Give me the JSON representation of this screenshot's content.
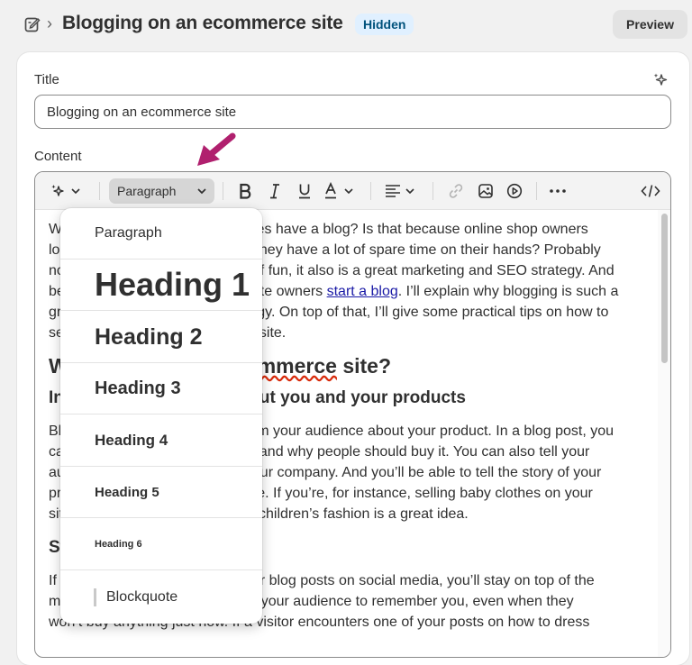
{
  "header": {
    "title": "Blogging on an ecommerce site",
    "badge": "Hidden",
    "preview_label": "Preview",
    "breadcrumb_separator": "›",
    "page_icon": "edit-page-icon"
  },
  "form": {
    "title_label": "Title",
    "title_value": "Blogging on an ecommerce site",
    "content_label": "Content"
  },
  "toolbar": {
    "block_format": "Paragraph",
    "icons": [
      "ai-sparkle-icon",
      "bold-icon",
      "italic-icon",
      "underline-icon",
      "text-color-icon",
      "align-icon",
      "link-icon",
      "image-icon",
      "video-icon",
      "more-icon",
      "html-icon"
    ]
  },
  "dropdown": {
    "options": [
      "Paragraph",
      "Heading 1",
      "Heading 2",
      "Heading 3",
      "Heading 4",
      "Heading 5",
      "Heading 6",
      "Blockquote"
    ]
  },
  "body": {
    "p1a": "W",
    "p1a_right": "tes have a blog? Is that because online shop owners",
    "p1b": "lo",
    "p1b_right": "they have a lot of spare time on their hands? Probably",
    "p1c": "no",
    "p1c_right": "f fun, it also is a great marketing and SEO strategy. And",
    "p1d": "be",
    "p1d_right_1": "te owners ",
    "p1d_link": "start a blog",
    "p1d_right_2": ". I’ll explain why blogging is such a",
    "p1e": "gr",
    "p1e_right": "gy. On top of that, I’ll give some practical tips on how to",
    "p1f": "se",
    "p1f_right": "site.",
    "h2a": "W",
    "h2a_squiggle": "mmerce",
    "h2a_right": " site?",
    "h3a": "In",
    "h3a_right": "ut you and your products",
    "p2a": "Bl",
    "p2a_right": "m your audience about your product. In a blog post, you",
    "p2b": "ca",
    "p2b_right": "and why people should buy it. You can also tell your",
    "p2c": "au",
    "p2c_right": "ur company. And you’ll be able to tell the story of your",
    "p2d": "pr",
    "p2d_right": "e. If you’re, for instance, selling baby clothes on your",
    "p2e": "sit",
    "p2e_right": "children’s fashion is a great idea.",
    "h3b": "St",
    "p3a": "If",
    "p3a_right": "ur blog posts on social media, you’ll stay on top of the",
    "p3b": "mind of your audience. You want your audience to remember you, even when they",
    "p3c": "won’t buy anything just now. If a visitor encounters one of your posts on how to dress"
  },
  "annotation": {
    "color": "#b0206e"
  }
}
